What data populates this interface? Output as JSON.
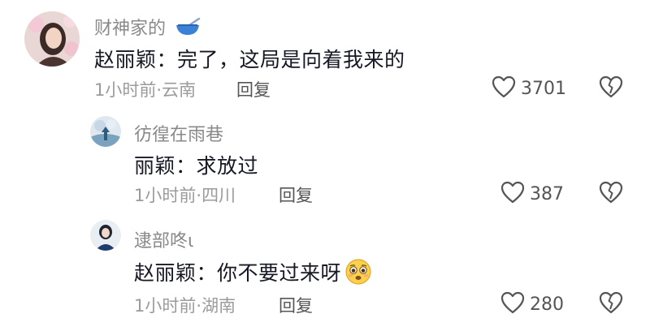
{
  "comments": [
    {
      "username": "财神家的",
      "username_emoji": "bowl-emoji",
      "text": "赵丽颖：完了，这局是向着我来的",
      "time": "1小时前",
      "location": "云南",
      "reply_label": "回复",
      "likes": "3701"
    },
    {
      "username": "彷徨在雨巷",
      "text": "丽颖：求放过",
      "time": "1小时前",
      "location": "四川",
      "reply_label": "回复",
      "likes": "387"
    },
    {
      "username": "逮部咚ι",
      "text": "赵丽颖：你不要过来呀",
      "text_emoji": "pleading-face-emoji",
      "time": "1小时前",
      "location": "湖南",
      "reply_label": "回复",
      "likes": "280"
    }
  ],
  "meta_separator": "·",
  "colors": {
    "text": "#161823",
    "muted": "#9b9b9b",
    "icon": "#555555"
  }
}
